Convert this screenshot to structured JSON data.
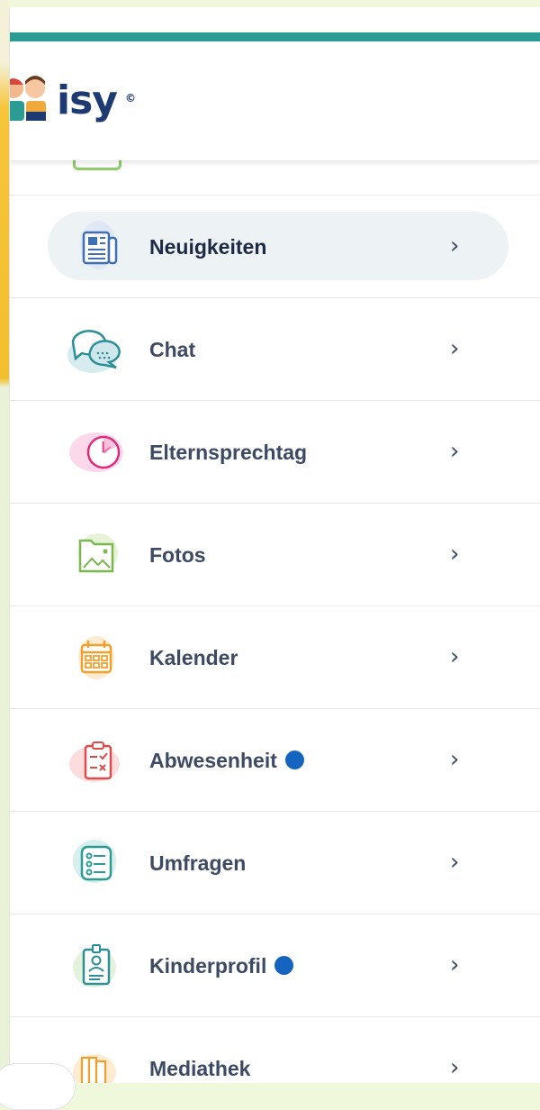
{
  "app": {
    "logo_text": "isy",
    "logo_mark": "©"
  },
  "colors": {
    "accent": "#2b9c95",
    "badge": "#1565c0",
    "active_bg": "#edf2f4"
  },
  "menu": {
    "items": [
      {
        "label": "Neuigkeiten",
        "icon": "newspaper-icon",
        "active": true,
        "badge": false
      },
      {
        "label": "Chat",
        "icon": "chat-bubbles-icon",
        "active": false,
        "badge": false
      },
      {
        "label": "Elternsprechtag",
        "icon": "clock-icon",
        "active": false,
        "badge": false
      },
      {
        "label": "Fotos",
        "icon": "photo-folder-icon",
        "active": false,
        "badge": false
      },
      {
        "label": "Kalender",
        "icon": "calendar-icon",
        "active": false,
        "badge": false
      },
      {
        "label": "Abwesenheit",
        "icon": "absence-clipboard-icon",
        "active": false,
        "badge": true
      },
      {
        "label": "Umfragen",
        "icon": "survey-list-icon",
        "active": false,
        "badge": false
      },
      {
        "label": "Kinderprofil",
        "icon": "child-profile-icon",
        "active": false,
        "badge": true
      },
      {
        "label": "Mediathek",
        "icon": "library-books-icon",
        "active": false,
        "badge": false
      }
    ],
    "chevron": "›"
  }
}
